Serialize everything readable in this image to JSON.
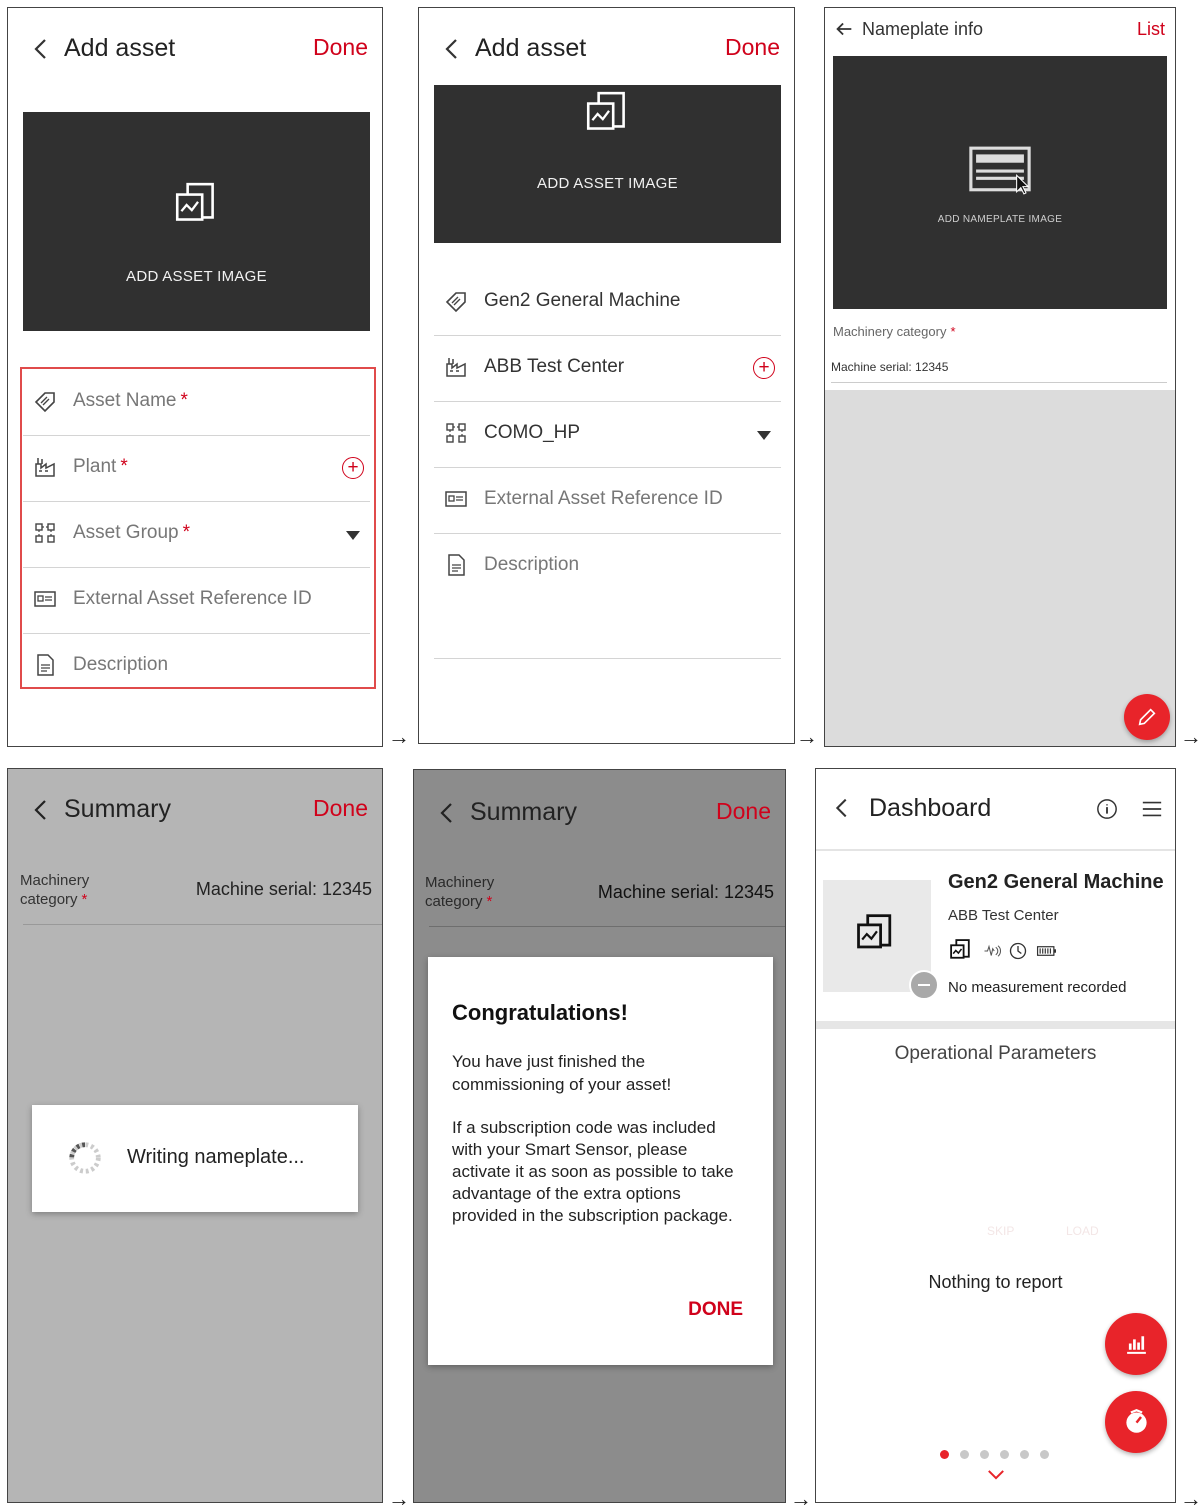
{
  "screen1": {
    "title": "Add asset",
    "done": "Done",
    "image_label": "ADD ASSET IMAGE",
    "fields": [
      {
        "label": "Asset Name",
        "req": "*"
      },
      {
        "label": "Plant",
        "req": "*"
      },
      {
        "label": "Asset Group",
        "req": "*"
      },
      {
        "label": "External Asset Reference ID"
      },
      {
        "label": "Description"
      }
    ]
  },
  "screen2": {
    "title": "Add asset",
    "done": "Done",
    "image_label": "ADD ASSET IMAGE",
    "fields": [
      {
        "label": "Gen2 General Machine"
      },
      {
        "label": "ABB Test Center"
      },
      {
        "label": "COMO_HP"
      },
      {
        "label": "External Asset Reference ID"
      },
      {
        "label": "Description"
      }
    ]
  },
  "screen3": {
    "title": "Nameplate info",
    "list": "List",
    "image_label": "ADD NAMEPLATE IMAGE",
    "category_label": "Machinery category",
    "req": "*",
    "serial": "Machine serial: 12345"
  },
  "screen4": {
    "title": "Summary",
    "done": "Done",
    "category_label": "Machinery category",
    "req": "*",
    "serial": "Machine serial: 12345",
    "writing": "Writing nameplate..."
  },
  "screen5": {
    "title": "Summary",
    "done": "Done",
    "category_label": "Machinery category",
    "req": "*",
    "serial": "Machine serial: 12345",
    "dialog_title": "Congratulations!",
    "dialog_p1": "You have just finished the commissioning of your asset!",
    "dialog_p2": "If a subscription code was included with your Smart Sensor, please activate it as soon as possible to take advantage of the extra options provided in the subscription package.",
    "dialog_button": "DONE"
  },
  "screen6": {
    "title": "Dashboard",
    "asset_name": "Gen2 General Machine",
    "plant": "ABB Test Center",
    "no_measurement": "No measurement recorded",
    "section_title": "Operational Parameters",
    "faded_skip": "SKIP",
    "faded_load": "LOAD",
    "nothing": "Nothing to report",
    "page_dots": 6,
    "active_dot": 1
  },
  "arrow": "→",
  "colors": {
    "accent": "#d0021b",
    "fab": "#e8242a",
    "dark_image": "#303030",
    "overlay": "#b5b5b5"
  }
}
